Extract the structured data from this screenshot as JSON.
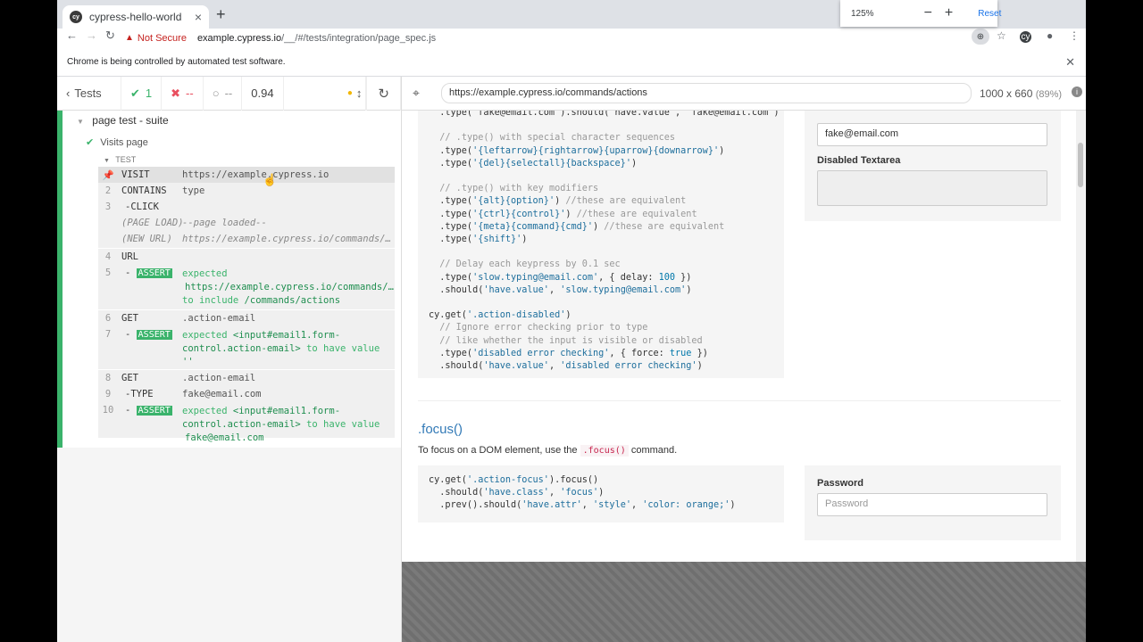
{
  "browser": {
    "tab_title": "cypress-hello-world",
    "tab_favicon": "cy",
    "new_tab": "+",
    "not_secure": "Not Secure",
    "url_host": "example.cypress.io",
    "url_path": "/__/#/tests/integration/page_spec.js",
    "zoom_popup": {
      "level": "125%",
      "minus": "−",
      "plus": "+",
      "reset": "Reset"
    },
    "infobar_text": "Chrome is being controlled by automated test software.",
    "infobar_close": "✕"
  },
  "reporter": {
    "tests_label": "Tests",
    "passed": "1",
    "failed": "--",
    "pending": "--",
    "duration": "0.94",
    "suite": "page test - suite",
    "test": "Visits page",
    "test_label": "TEST",
    "commands": [
      {
        "num": "",
        "name": "VISIT",
        "message": "https://example.cypress.io"
      },
      {
        "num": "2",
        "name": "CONTAINS",
        "message": "type"
      },
      {
        "num": "3",
        "name": "-CLICK",
        "message": ""
      },
      {
        "num": "",
        "name": "(PAGE LOAD)",
        "message": "--page loaded--"
      },
      {
        "num": "",
        "name": "(NEW URL)",
        "message": "https://example.cypress.io/commands/…"
      },
      {
        "num": "4",
        "name": "URL",
        "message": ""
      },
      {
        "num": "5",
        "name": "ASSERT",
        "message_a": "expected",
        "message_b": "https://example.cypress.io/commands/…",
        "message_c": "to include",
        "message_d": "/commands/actions"
      },
      {
        "num": "6",
        "name": "GET",
        "message": ".action-email"
      },
      {
        "num": "7",
        "name": "ASSERT",
        "message_a": "expected",
        "message_b": "<input#email1.form-control.action-email>",
        "message_c": "to have value",
        "message_d": "''"
      },
      {
        "num": "8",
        "name": "GET",
        "message": ".action-email"
      },
      {
        "num": "9",
        "name": "-TYPE",
        "message": "fake@email.com"
      },
      {
        "num": "10",
        "name": "ASSERT",
        "message_a": "expected",
        "message_b": "<input#email1.form-control.action-email>",
        "message_c": "to have value",
        "message_d": "fake@email.com"
      }
    ]
  },
  "aut": {
    "url": "https://example.cypress.io/commands/actions",
    "viewport": "1000 x 660",
    "scale": "(89%)",
    "email_value": "fake@email.com",
    "disabled_textarea_label": "Disabled Textarea",
    "focus_heading": ".focus()",
    "focus_text_a": "To focus on a DOM element, use the",
    "focus_code": ".focus()",
    "focus_text_b": "command.",
    "password_label": "Password",
    "password_placeholder": "Password"
  }
}
